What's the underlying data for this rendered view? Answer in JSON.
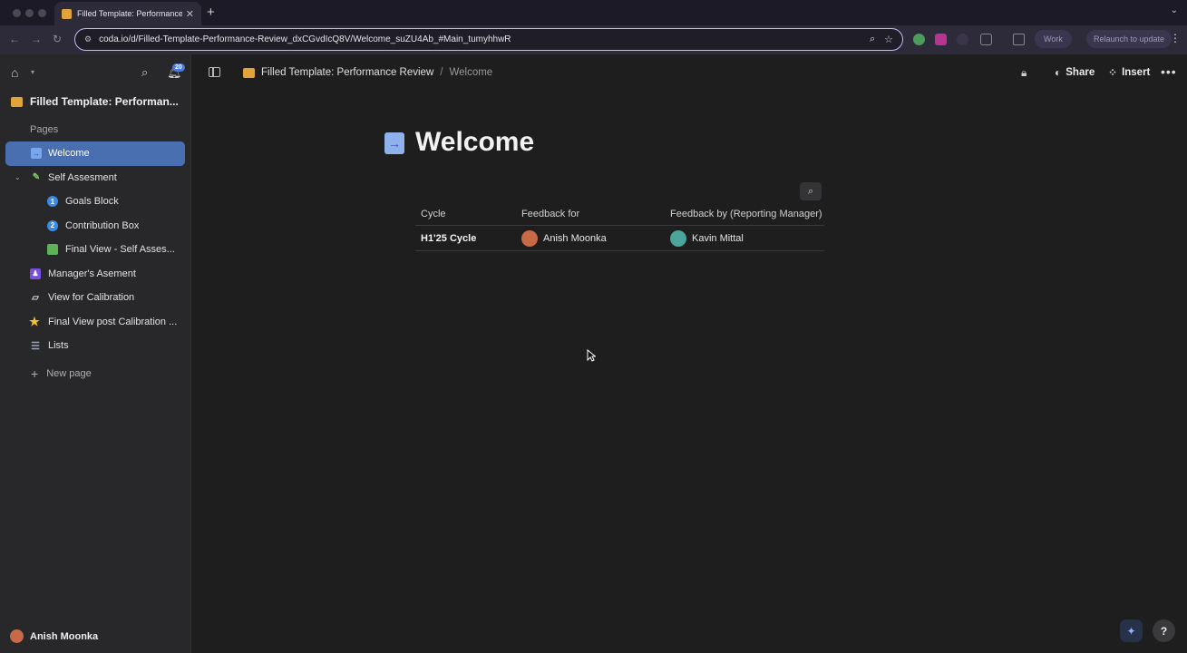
{
  "browser": {
    "tab_title": "Filled Template: Performance",
    "tab_close": "✕",
    "new_tab": "+",
    "url": "coda.io/d/Filled-Template-Performance-Review_dxCGvdIcQ8V/Welcome_suZU4Ab_#Main_tumyhhwR",
    "profile_label": "Work",
    "relaunch_label": "Relaunch to update"
  },
  "sidebar": {
    "notification_count": "20",
    "doc_name": "Filled Template: Performan...",
    "pages_label": "Pages",
    "items": [
      {
        "label": "Welcome",
        "icon": "arrow-page-icon",
        "color": "#7aa6ee"
      },
      {
        "label": "Self Assesment",
        "icon": "pencil-ruler-icon",
        "color": "#7cc46a"
      },
      {
        "label": "Goals Block",
        "icon": "number-1-icon",
        "badge": "1",
        "color": "#3a8be6"
      },
      {
        "label": "Contribution Box",
        "icon": "number-2-icon",
        "badge": "2",
        "color": "#3a8be6"
      },
      {
        "label": "Final View - Self Asses...",
        "icon": "green-book-icon",
        "color": "#5fb05a"
      },
      {
        "label": "Manager's Asement",
        "icon": "manager-icon",
        "color": "#7a4ee0"
      },
      {
        "label": "View for Calibration",
        "icon": "ruler-icon",
        "color": "#dddddd"
      },
      {
        "label": "Final View post Calibration ...",
        "icon": "star-icon",
        "color": "#f2c233"
      },
      {
        "label": "Lists",
        "icon": "stack-icon",
        "color": "#9aa6b8"
      }
    ],
    "new_page_label": "New page",
    "user_name": "Anish Moonka"
  },
  "doc_header": {
    "breadcrumb_doc": "Filled Template: Performance Review",
    "breadcrumb_sep": "/",
    "breadcrumb_page": "Welcome",
    "share_label": "Share",
    "insert_label": "Insert"
  },
  "page": {
    "title": "Welcome",
    "table": {
      "columns": [
        "Cycle",
        "Feedback for",
        "Feedback by (Reporting Manager)"
      ],
      "rows": [
        {
          "cycle": "H1'25 Cycle",
          "feedback_for": "Anish Moonka",
          "feedback_by": "Kavin Mittal"
        }
      ]
    }
  },
  "colors": {
    "accent": "#4a6fb0",
    "background": "#1e1e1f",
    "sidebar": "#28282a"
  }
}
